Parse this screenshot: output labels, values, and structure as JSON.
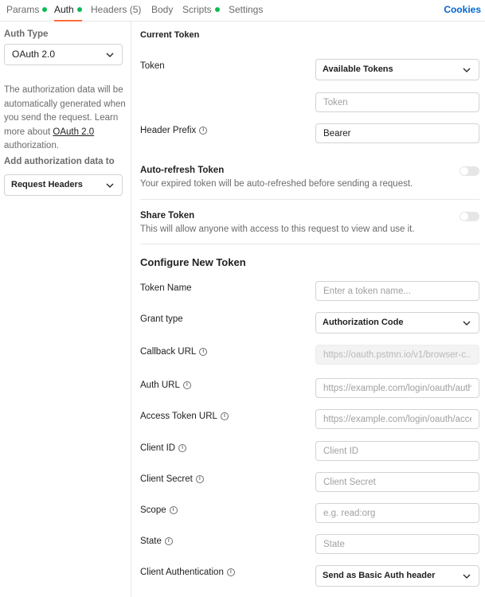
{
  "tabs": [
    {
      "label": "Params",
      "dot_color": "#0cbb52"
    },
    {
      "label": "Auth",
      "dot_color": "#0cbb52"
    },
    {
      "label": "Headers (5)"
    },
    {
      "label": "Body"
    },
    {
      "label": "Scripts",
      "dot_color": "#0cbb52"
    },
    {
      "label": "Settings"
    }
  ],
  "cookies_label": "Cookies",
  "left": {
    "auth_type_label": "Auth Type",
    "auth_type_value": "OAuth 2.0",
    "desc_text": "The authorization data will be automatically generated when you send the request. Learn more about ",
    "desc_link": "OAuth 2.0",
    "desc_tail": " authorization.",
    "add_auth_label": "Add authorization data to",
    "add_auth_value": "Request Headers"
  },
  "current_token": {
    "title": "Current Token",
    "token_label": "Token",
    "token_select": "Available Tokens",
    "token_placeholder": "Token",
    "header_prefix_label": "Header Prefix",
    "header_prefix_value": "Bearer",
    "auto_refresh_title": "Auto-refresh Token",
    "auto_refresh_desc": "Your expired token will be auto-refreshed before sending a request.",
    "share_title": "Share Token",
    "share_desc": "This will allow anyone with access to this request to view and use it."
  },
  "configure": {
    "title": "Configure New Token",
    "token_name_label": "Token Name",
    "token_name_placeholder": "Enter a token name...",
    "grant_type_label": "Grant type",
    "grant_type_value": "Authorization Code",
    "callback_label": "Callback URL",
    "callback_placeholder": "https://oauth.pstmn.io/v1/browser-c...",
    "auth_url_label": "Auth URL",
    "auth_url_placeholder": "https://example.com/login/oauth/auth",
    "access_token_url_label": "Access Token URL",
    "access_token_url_placeholder": "https://example.com/login/oauth/acce",
    "client_id_label": "Client ID",
    "client_id_placeholder": "Client ID",
    "client_secret_label": "Client Secret",
    "client_secret_placeholder": "Client Secret",
    "scope_label": "Scope",
    "scope_placeholder": "e.g. read:org",
    "state_label": "State",
    "state_placeholder": "State",
    "client_auth_label": "Client Authentication",
    "client_auth_value": "Send as Basic Auth header"
  },
  "colors": {
    "accent": "#ff6c37",
    "link": "#0265d2",
    "status_dot": "#0cbb52"
  },
  "icons": {
    "chevron": "chevron-down-icon",
    "info": "info-icon"
  }
}
